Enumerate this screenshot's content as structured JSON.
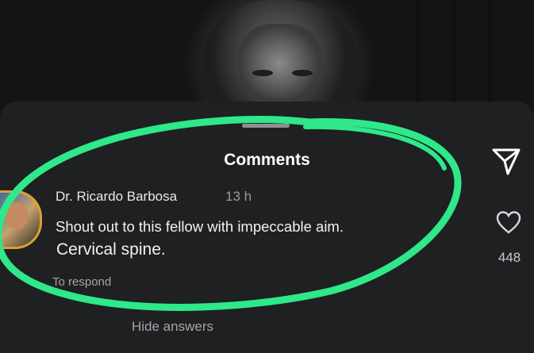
{
  "sheet": {
    "title": "Comments",
    "send_icon": "send-icon"
  },
  "comment": {
    "author": "Dr. Ricardo Barbosa",
    "time": "13 h",
    "text_line1": "Shout out to this fellow with impeccable aim.",
    "text_line2": "Cervical spine.",
    "reply_label": "To respond",
    "like_icon": "heart-icon",
    "like_count": "448"
  },
  "thread": {
    "hide_answers_label": "Hide answers"
  },
  "colors": {
    "highlight": "#2ee88a",
    "sheet_bg": "#1f2022",
    "avatar_ring": "#e0a030"
  }
}
